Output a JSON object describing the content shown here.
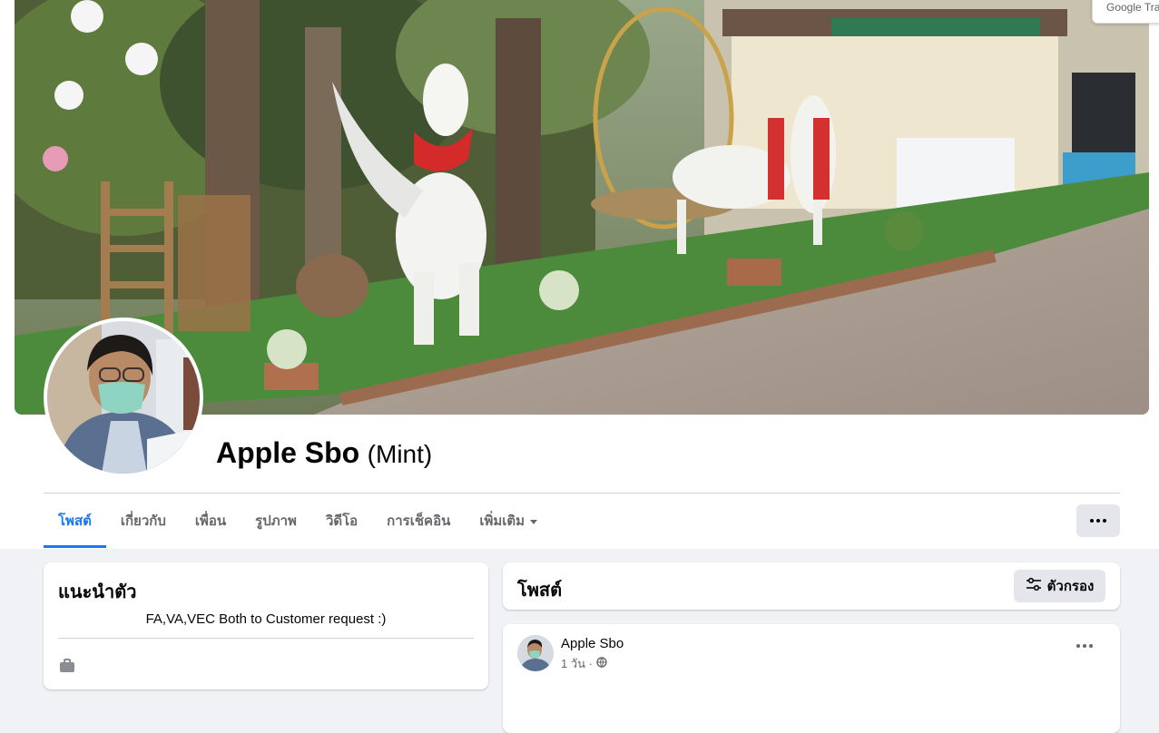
{
  "browser": {
    "translate_badge": "Google Tra"
  },
  "profile": {
    "name": "Apple Sbo",
    "alt_name": "(Mint)"
  },
  "tabs": [
    {
      "label": "โพสต์",
      "active": true
    },
    {
      "label": "เกี่ยวกับ"
    },
    {
      "label": "เพื่อน"
    },
    {
      "label": "รูปภาพ"
    },
    {
      "label": "วิดีโอ"
    },
    {
      "label": "การเช็คอิน"
    },
    {
      "label": "เพิ่มเติม"
    }
  ],
  "more_button_icon": "more-horizontal-icon",
  "intro": {
    "title": "แนะนำตัว",
    "bio": "FA,VA,VEC Both to Customer request :)"
  },
  "posts": {
    "title": "โพสต์",
    "filter_label": "ตัวกรอง",
    "first_post": {
      "author": "Apple Sbo",
      "time": "1 วัน ·"
    }
  },
  "colors": {
    "accent": "#1877f2",
    "page_bg": "#f0f2f5",
    "button_bg": "#e4e6eb"
  }
}
